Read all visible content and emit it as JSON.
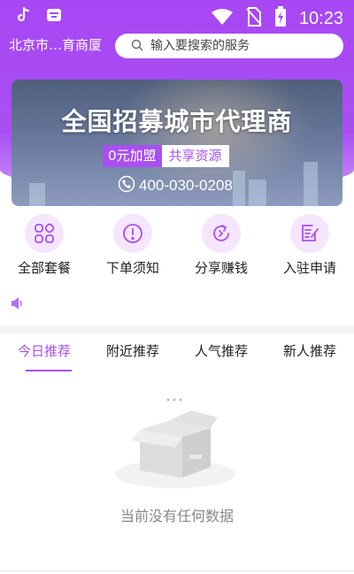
{
  "status_bar": {
    "time": "10:23",
    "icons": [
      "tiktok-icon",
      "calendar-app-icon",
      "wifi-icon",
      "no-sim-icon",
      "battery-charging-icon"
    ]
  },
  "header": {
    "location": "北京市…育商厦",
    "search_placeholder": "输入要搜索的服务"
  },
  "banner": {
    "title": "全国招募城市代理商",
    "tag_join": "0元加盟",
    "tag_share": "共享资源",
    "phone": "400-030-0208"
  },
  "quick_menu": [
    {
      "label": "全部套餐",
      "icon": "grid-icon"
    },
    {
      "label": "下单须知",
      "icon": "exclamation-icon"
    },
    {
      "label": "分享赚钱",
      "icon": "share-refresh-icon"
    },
    {
      "label": "入驻申请",
      "icon": "edit-document-icon"
    }
  ],
  "tabs": [
    {
      "label": "今日推荐",
      "active": true
    },
    {
      "label": "附近推荐",
      "active": false
    },
    {
      "label": "人气推荐",
      "active": false
    },
    {
      "label": "新人推荐",
      "active": false
    }
  ],
  "empty_state": {
    "text": "当前没有任何数据"
  },
  "colors": {
    "accent": "#a94ff2",
    "icon_bg": "#f6e6fd"
  }
}
